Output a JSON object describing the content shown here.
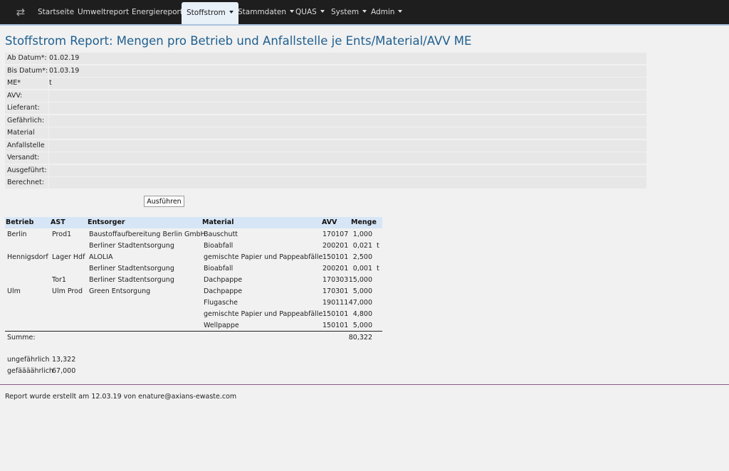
{
  "nav": {
    "toggle_icon": "swap-arrows-icon",
    "items": [
      {
        "label": "Startseite",
        "active": false,
        "dropdown": false
      },
      {
        "label": "Umweltreport",
        "active": false,
        "dropdown": false
      },
      {
        "label": "Energiereport",
        "active": false,
        "dropdown": false
      },
      {
        "label": "Stoffstrom",
        "active": true,
        "dropdown": true
      },
      {
        "label": "Stammdaten",
        "active": false,
        "dropdown": true
      },
      {
        "label": "QUAS",
        "active": false,
        "dropdown": true
      },
      {
        "label": "System",
        "active": false,
        "dropdown": true
      },
      {
        "label": "Admin",
        "active": false,
        "dropdown": true
      }
    ]
  },
  "title": "Stoffstrom Report: Mengen pro Betrieb und Anfallstelle je Ents/Material/AVV ME",
  "filters": [
    {
      "label": "Ab Datum*:",
      "value": "01.02.19"
    },
    {
      "label": "Bis Datum*:",
      "value": "01.03.19"
    },
    {
      "label": "ME*",
      "value": "t"
    },
    {
      "label": "AVV:",
      "value": ""
    },
    {
      "label": "Lieferant:",
      "value": ""
    },
    {
      "label": "Gefährlich:",
      "value": ""
    },
    {
      "label": "Material",
      "value": ""
    },
    {
      "label": "Anfallstelle",
      "value": ""
    },
    {
      "label": "Versandt:",
      "value": ""
    },
    {
      "label": "Ausgeführt:",
      "value": ""
    },
    {
      "label": "Berechnet:",
      "value": ""
    }
  ],
  "run_button": "Ausführen",
  "table": {
    "headers": {
      "betrieb": "Betrieb",
      "ast": "AST",
      "entsorger": "Entsorger",
      "material": "Material",
      "avv": "AVV",
      "menge": "Menge"
    },
    "rows": [
      {
        "betrieb": "Berlin",
        "ast": "Prod1",
        "entsorger": "Baustoffaufbereitung Berlin GmbH",
        "material": "Bauschutt",
        "avv": "170107",
        "menge": "1,000",
        "unit": ""
      },
      {
        "betrieb": "",
        "ast": "",
        "entsorger": "Berliner Stadtentsorgung",
        "material": "Bioabfall",
        "avv": "200201",
        "menge": "0,021",
        "unit": "t"
      },
      {
        "betrieb": "Hennigsdorf",
        "ast": "Lager Hdf",
        "entsorger": "ALOLIA",
        "material": "gemischte Papier und Pappeabfälle",
        "avv": "150101",
        "menge": "2,500",
        "unit": ""
      },
      {
        "betrieb": "",
        "ast": "",
        "entsorger": "Berliner Stadtentsorgung",
        "material": "Bioabfall",
        "avv": "200201",
        "menge": "0,001",
        "unit": "t"
      },
      {
        "betrieb": "",
        "ast": "Tor1",
        "entsorger": "Berliner Stadtentsorgung",
        "material": "Dachpappe",
        "avv": "170303",
        "menge": "15,000",
        "unit": ""
      },
      {
        "betrieb": "Ulm",
        "ast": "Ulm Prod",
        "entsorger": "Green Entsorgung",
        "material": "Dachpappe",
        "avv": "170301",
        "menge": "5,000",
        "unit": ""
      },
      {
        "betrieb": "",
        "ast": "",
        "entsorger": "",
        "material": "Flugasche",
        "avv": "190111",
        "menge": "47,000",
        "unit": ""
      },
      {
        "betrieb": "",
        "ast": "",
        "entsorger": "",
        "material": "gemischte Papier und Pappeabfälle",
        "avv": "150101",
        "menge": "4,800",
        "unit": ""
      },
      {
        "betrieb": "",
        "ast": "",
        "entsorger": "",
        "material": "Wellpappe",
        "avv": "150101",
        "menge": "5,000",
        "unit": ""
      }
    ],
    "sum_label": "Summe:",
    "sum_value": "80,322"
  },
  "stats": [
    {
      "label": "ungefährlich",
      "value": "13,322"
    },
    {
      "label": "gefäääährlich",
      "value": "67,000"
    }
  ],
  "footer": "Report wurde erstellt am 12.03.19 von enature@axians-ewaste.com"
}
